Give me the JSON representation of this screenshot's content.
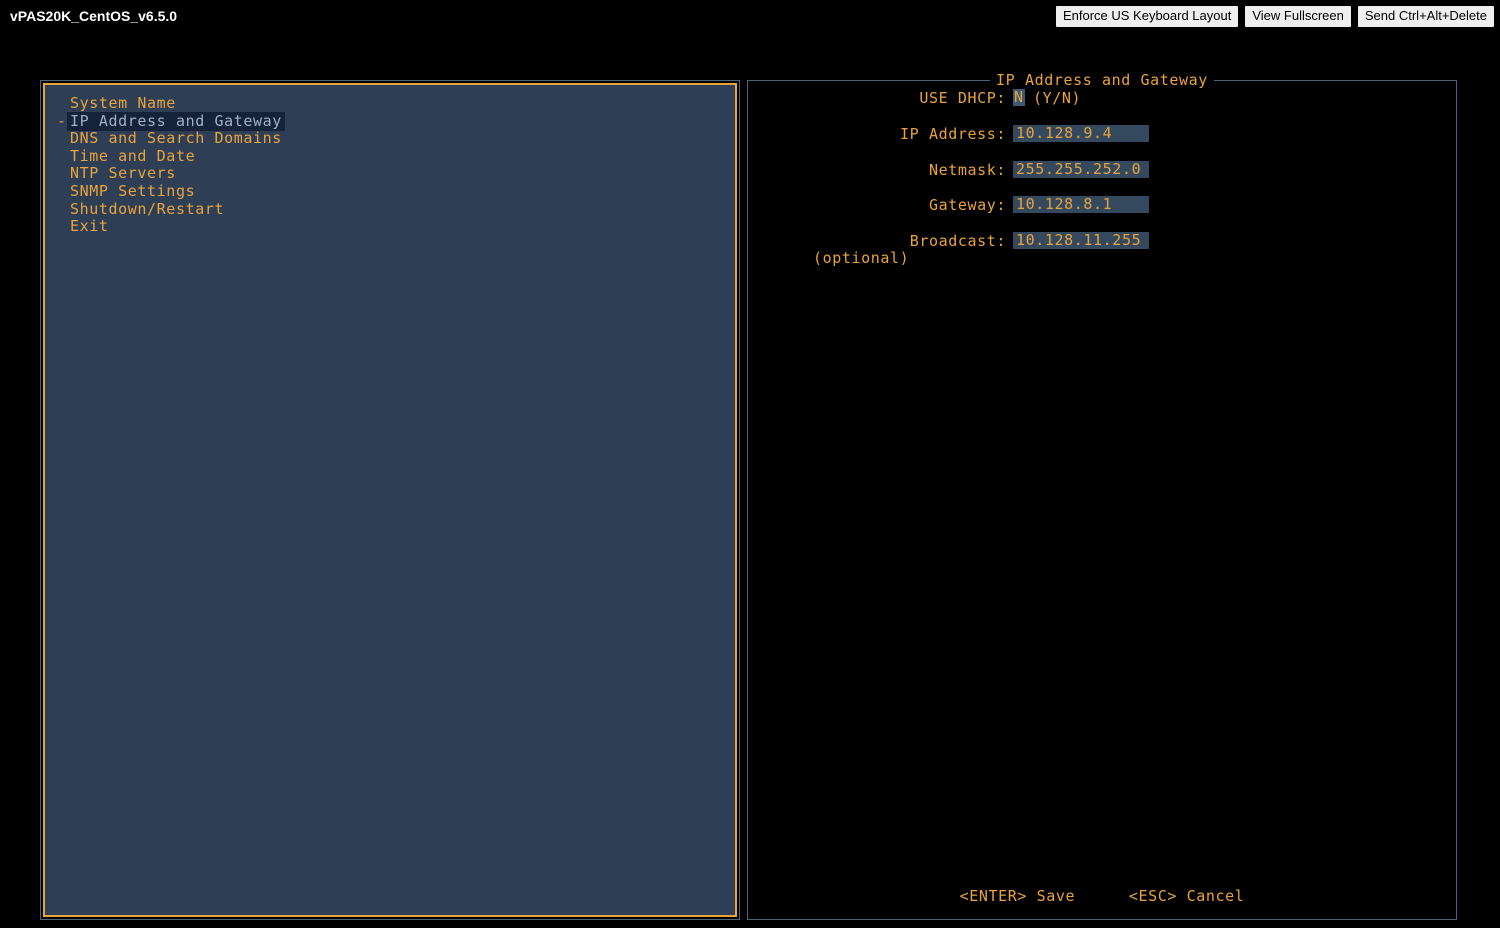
{
  "titlebar": {
    "console_title": "vPAS20K_CentOS_v6.5.0",
    "buttons": [
      {
        "label": "Enforce US Keyboard Layout",
        "name": "enforce-us-keyboard-layout-button"
      },
      {
        "label": "View Fullscreen",
        "name": "view-fullscreen-button"
      },
      {
        "label": "Send Ctrl+Alt+Delete",
        "name": "send-ctrl-alt-delete-button"
      }
    ]
  },
  "menu": {
    "selected_index": 1,
    "marker": "-",
    "items": [
      {
        "label": "System Name"
      },
      {
        "label": "IP Address and Gateway"
      },
      {
        "label": "DNS and Search Domains"
      },
      {
        "label": "Time and Date"
      },
      {
        "label": "NTP Servers"
      },
      {
        "label": "SNMP Settings"
      },
      {
        "label": "Shutdown/Restart"
      },
      {
        "label": "Exit"
      }
    ]
  },
  "form": {
    "title": "IP Address and Gateway",
    "fields": [
      {
        "label": "USE DHCP:",
        "value": "N",
        "suffix": "(Y/N)",
        "type": "char",
        "name": "use-dhcp-field"
      },
      {
        "label": "IP Address:",
        "value": "10.128.9.4",
        "type": "box",
        "name": "ip-address-field"
      },
      {
        "label": "Netmask:",
        "value": "255.255.252.0",
        "type": "box",
        "name": "netmask-field"
      },
      {
        "label": "Gateway:",
        "value": "10.128.8.1",
        "type": "box",
        "name": "gateway-field"
      },
      {
        "label": "Broadcast:",
        "value": "10.128.11.255",
        "sub_label": "(optional)",
        "type": "box",
        "name": "broadcast-field"
      }
    ],
    "footer": {
      "save": "<ENTER> Save",
      "cancel": "<ESC> Cancel"
    }
  },
  "colors": {
    "accent_orange": "#e8a33d",
    "panel_navy": "#2e3f55",
    "field_bg": "#34495e",
    "border_blue": "#4a6180",
    "selected_bg": "#16213a",
    "selected_fg": "#9fb0c6",
    "background": "#000000"
  }
}
